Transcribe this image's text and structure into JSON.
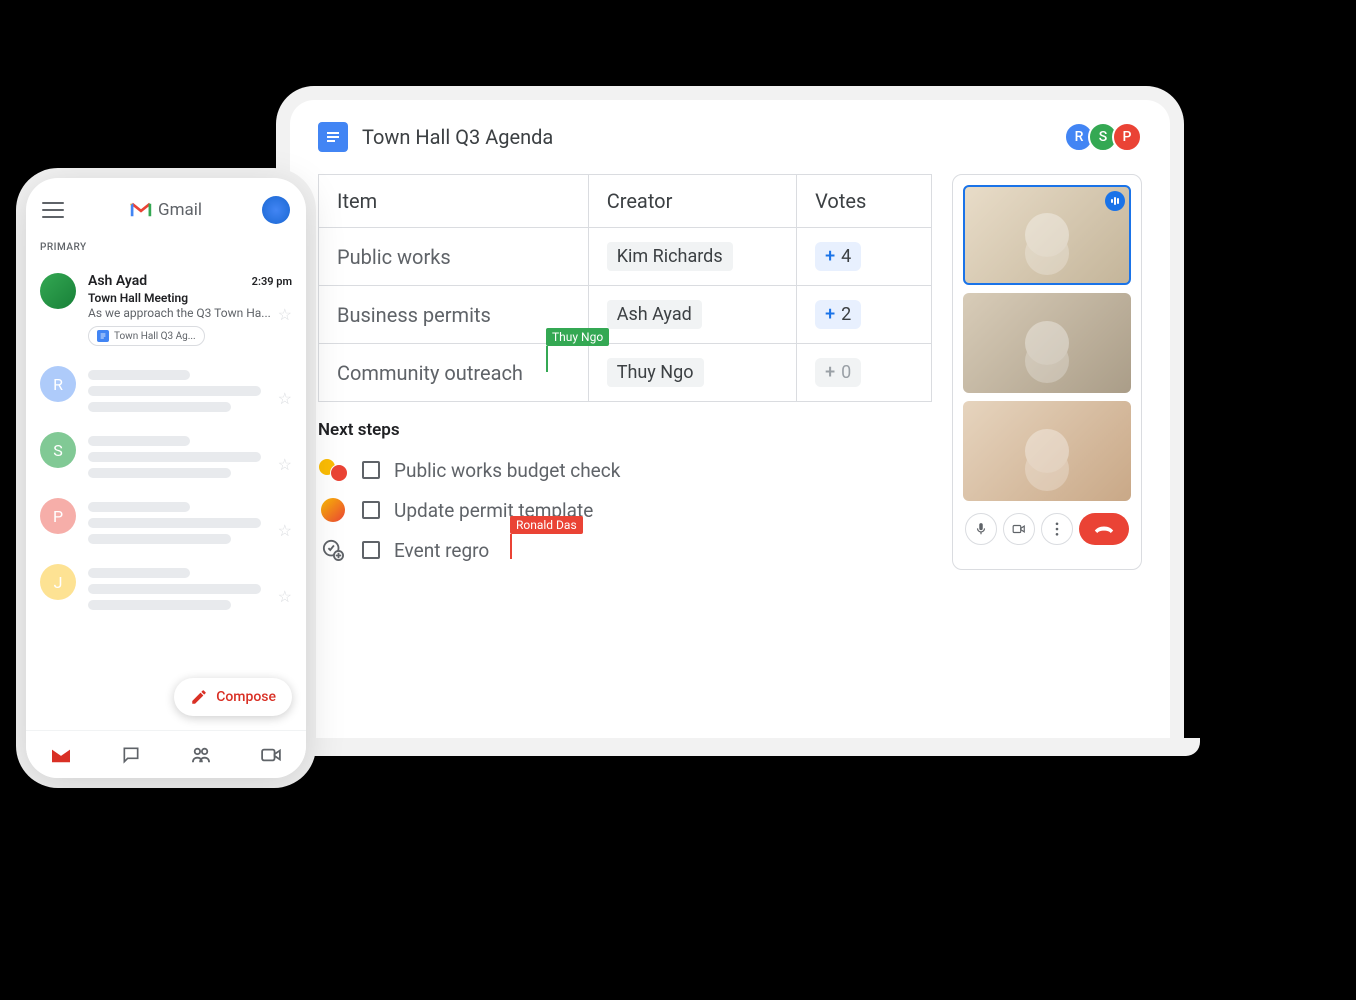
{
  "gmail": {
    "brand": "Gmail",
    "primary_label": "PRIMARY",
    "compose_label": "Compose",
    "email": {
      "sender": "Ash Ayad",
      "time": "2:39 pm",
      "subject": "Town Hall Meeting",
      "preview": "As we approach the Q3 Town Ha...",
      "chip": "Town Hall Q3 Ag..."
    },
    "placeholder_avatars": [
      {
        "letter": "R",
        "color": "#aecbfa"
      },
      {
        "letter": "S",
        "color": "#81c995"
      },
      {
        "letter": "P",
        "color": "#f6aea9"
      },
      {
        "letter": "J",
        "color": "#fde293"
      }
    ]
  },
  "doc": {
    "title": "Town Hall Q3 Agenda",
    "collaborators": [
      {
        "letter": "R",
        "color": "#4285f4"
      },
      {
        "letter": "S",
        "color": "#34a853"
      },
      {
        "letter": "P",
        "color": "#ea4335"
      }
    ],
    "table": {
      "headers": {
        "item": "Item",
        "creator": "Creator",
        "votes": "Votes"
      },
      "rows": [
        {
          "item": "Public works",
          "creator": "Kim Richards",
          "votes": "4",
          "disabled": false
        },
        {
          "item": "Business permits",
          "creator": "Ash Ayad",
          "votes": "2",
          "disabled": false
        },
        {
          "item": "Community outreach",
          "creator": "Thuy Ngo",
          "votes": "0",
          "disabled": true
        }
      ]
    },
    "cursor_tags": {
      "thuy": "Thuy Ngo",
      "ronald": "Ronald Das"
    },
    "next_steps": {
      "title": "Next steps",
      "items": [
        "Public works budget check",
        "Update permit template",
        "Event regro"
      ]
    }
  }
}
